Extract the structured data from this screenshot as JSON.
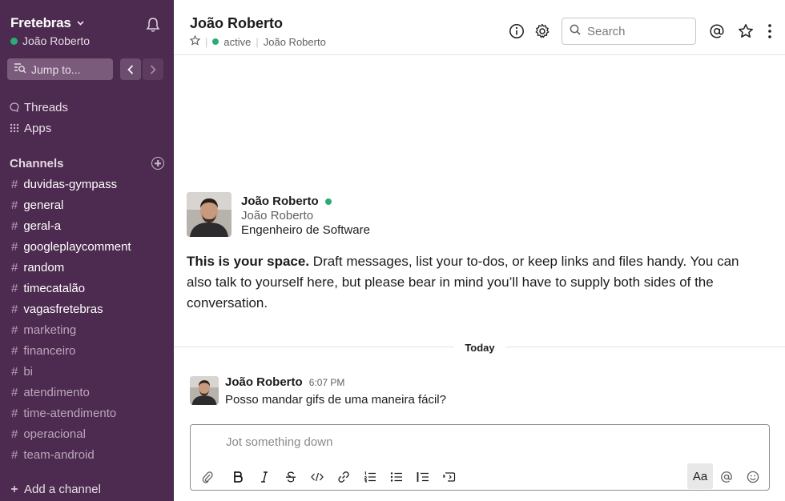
{
  "workspace": {
    "name": "Fretebras",
    "user": "João Roberto"
  },
  "sidebar": {
    "jump_label": "Jump to...",
    "items": [
      {
        "label": "Threads",
        "icon": "threads-icon"
      },
      {
        "label": "Apps",
        "icon": "apps-grid-icon"
      }
    ],
    "channels_header": "Channels",
    "channels": [
      {
        "name": "duvidas-gympass",
        "unread": true
      },
      {
        "name": "general",
        "unread": true
      },
      {
        "name": "geral-a",
        "unread": true
      },
      {
        "name": "googleplaycomment",
        "unread": true
      },
      {
        "name": "random",
        "unread": true
      },
      {
        "name": "timecatalão",
        "unread": true
      },
      {
        "name": "vagasfretebras",
        "unread": true
      },
      {
        "name": "marketing",
        "unread": false
      },
      {
        "name": "financeiro",
        "unread": false
      },
      {
        "name": "bi",
        "unread": false
      },
      {
        "name": "atendimento",
        "unread": false
      },
      {
        "name": "time-atendimento",
        "unread": false
      },
      {
        "name": "operacional",
        "unread": false
      },
      {
        "name": "team-android",
        "unread": false
      }
    ],
    "add_channel": "Add a channel",
    "hash": "#"
  },
  "header": {
    "title": "João Roberto",
    "status": "active",
    "sep": "|",
    "meta_name": "João Roberto",
    "search_placeholder": "Search"
  },
  "intro": {
    "name": "João Roberto",
    "display_name": "João Roberto",
    "role": "Engenheiro de Software",
    "bold": "This is your space.",
    "text": " Draft messages, list your to-dos, or keep links and files handy. You can also talk to yourself here, but please bear in mind you’ll have to supply both sides of the conversation."
  },
  "day_divider": "Today",
  "message": {
    "author": "João Roberto",
    "time": "6:07 PM",
    "text": "Posso mandar gifs de uma maneira fácil?"
  },
  "composer": {
    "placeholder": "Jot something down",
    "format_label": "Aa"
  },
  "colors": {
    "sidebar": "#4d2a4f",
    "presence": "#2bac76"
  }
}
